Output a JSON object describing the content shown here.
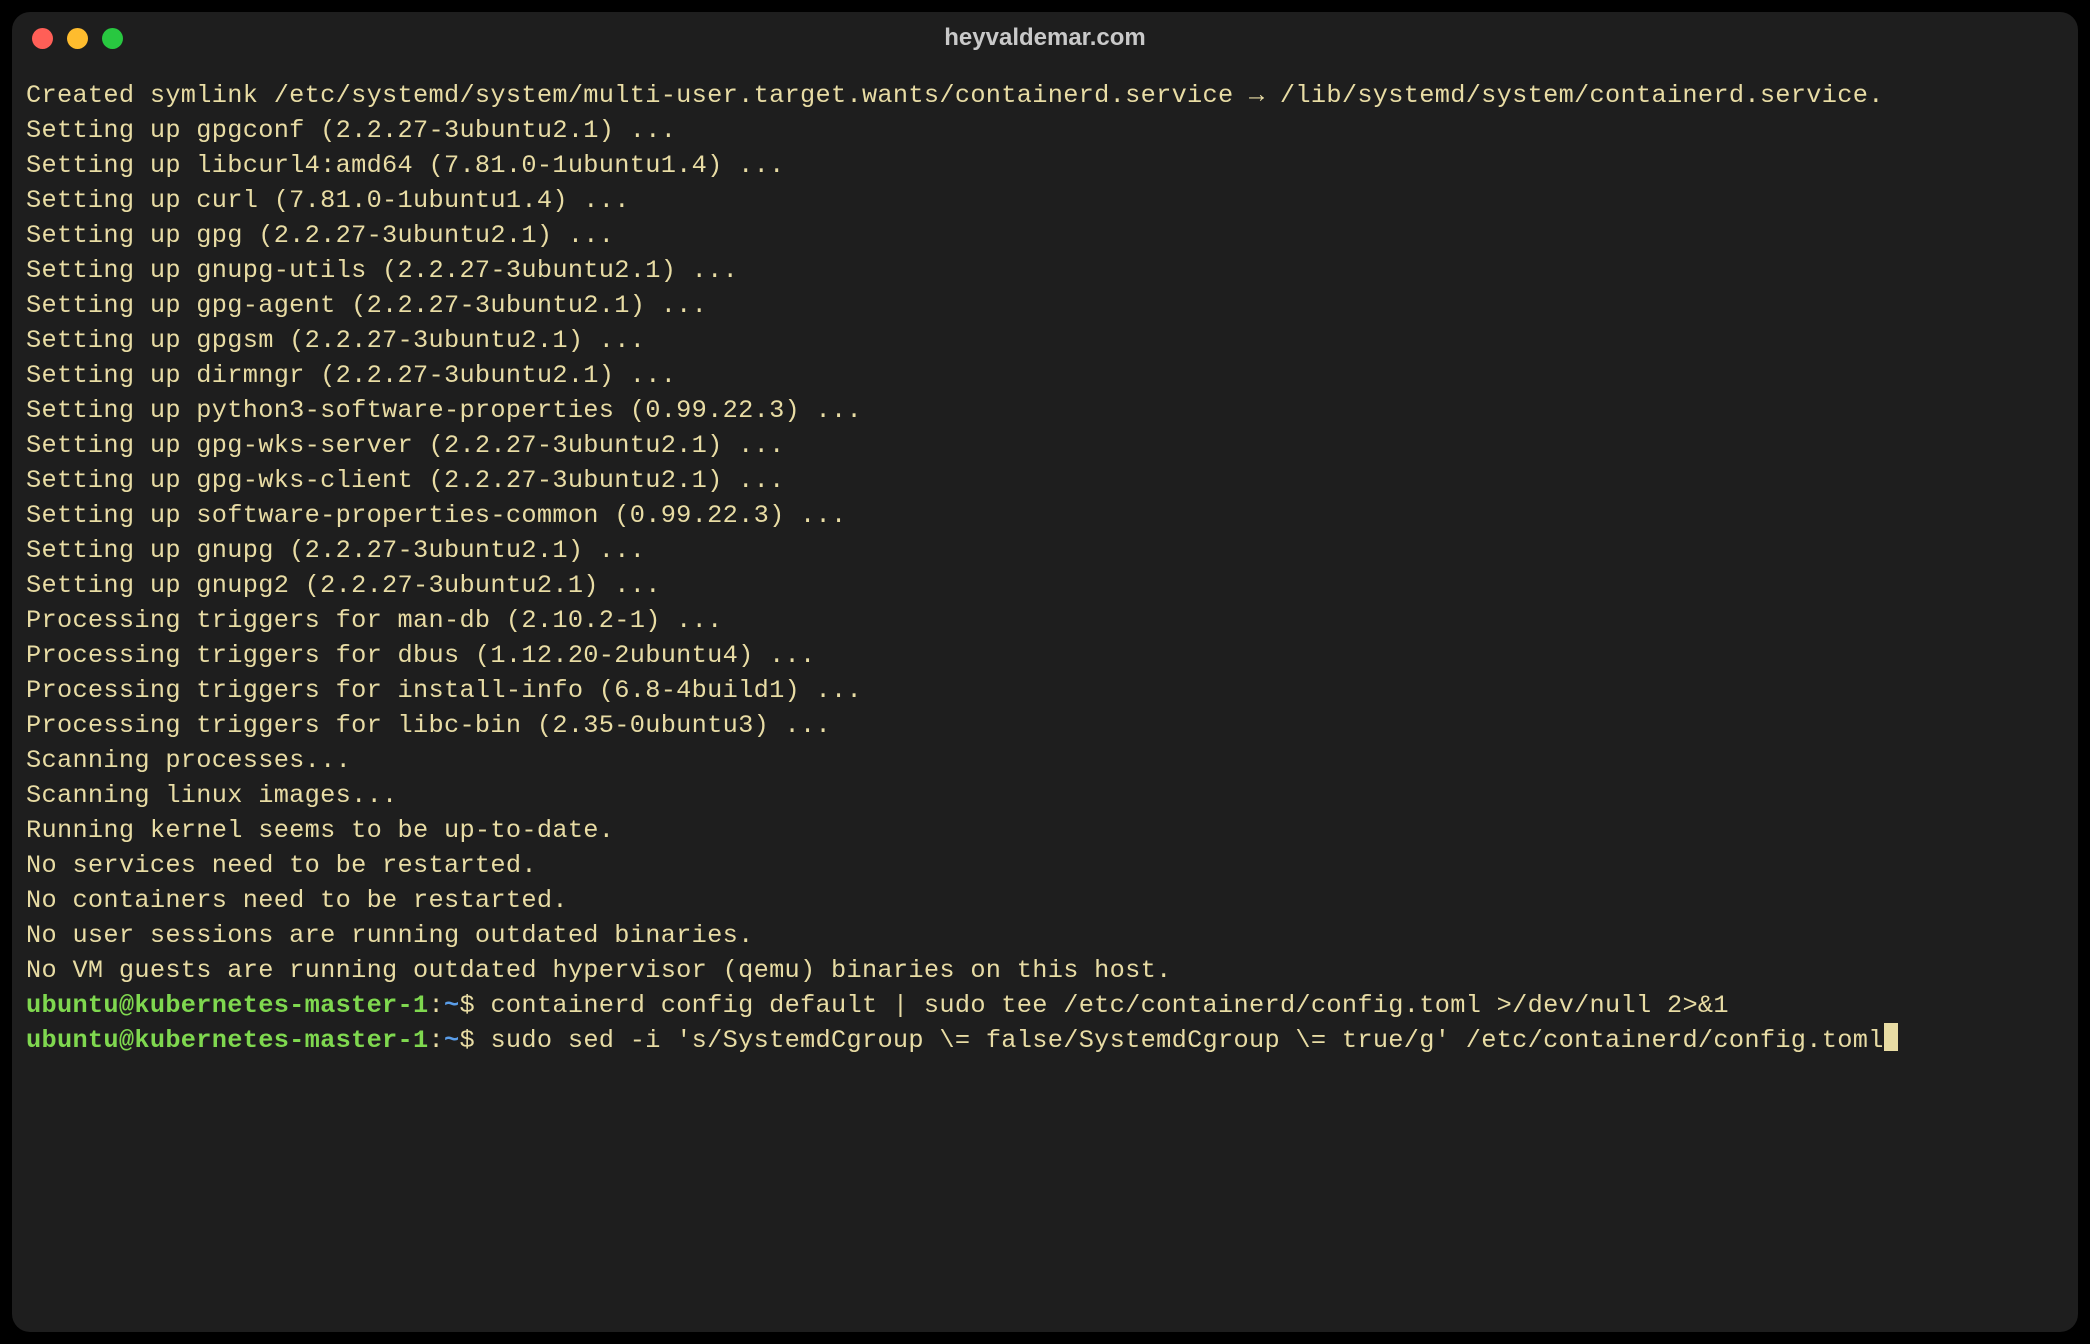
{
  "window": {
    "title": "heyvaldemar.com"
  },
  "traffic": {
    "close": "#ff5f57",
    "min": "#febc2e",
    "max": "#28c840"
  },
  "output": {
    "l00": "Created symlink /etc/systemd/system/multi-user.target.wants/containerd.service → /lib/systemd/system/containerd.service.",
    "l01": "Setting up gpgconf (2.2.27-3ubuntu2.1) ...",
    "l02": "Setting up libcurl4:amd64 (7.81.0-1ubuntu1.4) ...",
    "l03": "Setting up curl (7.81.0-1ubuntu1.4) ...",
    "l04": "Setting up gpg (2.2.27-3ubuntu2.1) ...",
    "l05": "Setting up gnupg-utils (2.2.27-3ubuntu2.1) ...",
    "l06": "Setting up gpg-agent (2.2.27-3ubuntu2.1) ...",
    "l07": "Setting up gpgsm (2.2.27-3ubuntu2.1) ...",
    "l08": "Setting up dirmngr (2.2.27-3ubuntu2.1) ...",
    "l09": "Setting up python3-software-properties (0.99.22.3) ...",
    "l10": "Setting up gpg-wks-server (2.2.27-3ubuntu2.1) ...",
    "l11": "Setting up gpg-wks-client (2.2.27-3ubuntu2.1) ...",
    "l12": "Setting up software-properties-common (0.99.22.3) ...",
    "l13": "Setting up gnupg (2.2.27-3ubuntu2.1) ...",
    "l14": "Setting up gnupg2 (2.2.27-3ubuntu2.1) ...",
    "l15": "Processing triggers for man-db (2.10.2-1) ...",
    "l16": "Processing triggers for dbus (1.12.20-2ubuntu4) ...",
    "l17": "Processing triggers for install-info (6.8-4build1) ...",
    "l18": "Processing triggers for libc-bin (2.35-0ubuntu3) ...",
    "l19": "Scanning processes...",
    "l20": "Scanning linux images...",
    "l21": "",
    "l22": "Running kernel seems to be up-to-date.",
    "l23": "",
    "l24": "No services need to be restarted.",
    "l25": "",
    "l26": "No containers need to be restarted.",
    "l27": "",
    "l28": "No user sessions are running outdated binaries.",
    "l29": "",
    "l30": "No VM guests are running outdated hypervisor (qemu) binaries on this host."
  },
  "prompts": {
    "userhost": "ubuntu@kubernetes-master-1",
    "sep": ":",
    "path": "~",
    "dollar": "$ ",
    "cmd1": "containerd config default | sudo tee /etc/containerd/config.toml >/dev/null 2>&1",
    "cmd2": "sudo sed -i 's/SystemdCgroup \\= false/SystemdCgroup \\= true/g' /etc/containerd/config.toml"
  }
}
